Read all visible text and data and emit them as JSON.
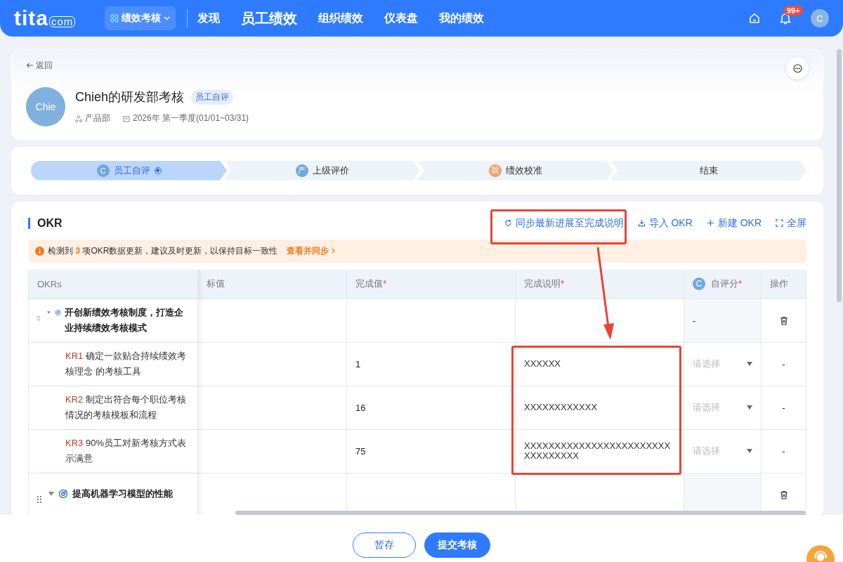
{
  "nav": {
    "logo": "tita",
    "logo_suffix": "com",
    "module": "绩效考核",
    "items": [
      {
        "label": "发现",
        "selected": false
      },
      {
        "label": "员工绩效",
        "selected": true
      },
      {
        "label": "组织绩效",
        "selected": false
      },
      {
        "label": "仪表盘",
        "selected": false
      },
      {
        "label": "我的绩效",
        "selected": false
      }
    ],
    "notification_badge": "99+",
    "avatar": "C"
  },
  "header": {
    "back": "返回",
    "avatar": "Chie",
    "title": "Chieh的研发部考核",
    "tag": "员工自评",
    "department": "产品部",
    "period": "2026年 第一季度(01/01~03/31)"
  },
  "steps": [
    {
      "badge": "C",
      "label": "员工自评",
      "color": "#6fa8dc",
      "selected": true
    },
    {
      "badge": "产",
      "label": "上级评价",
      "color": "#6fa8dc",
      "selected": false
    },
    {
      "badge": "我",
      "label": "绩效校准",
      "color": "#f0a070",
      "selected": false
    },
    {
      "label": "结束",
      "selected": false
    }
  ],
  "okr": {
    "title": "OKR",
    "actions": [
      {
        "kind": "sync",
        "label": "同步最新进展至完成说明"
      },
      {
        "kind": "import",
        "label": "导入 OKR"
      },
      {
        "kind": "new",
        "label": "新建 OKR"
      },
      {
        "kind": "fullscreen",
        "label": "全屏"
      }
    ],
    "notice": {
      "prefix": "检测到",
      "count": "3",
      "suffix": "项OKR数据更新，建议及时更新，以保持目标一致性",
      "link": "查看并同步"
    },
    "table": {
      "columns": [
        {
          "label": "OKRs"
        },
        {
          "label": "标值"
        },
        {
          "label": "完成值",
          "mark": "*"
        },
        {
          "label": "完成说明",
          "mark": "*"
        },
        {
          "label": "自评分",
          "mark": "*",
          "badge": "C"
        },
        {
          "label": "操作"
        }
      ],
      "rows": [
        {
          "kind": "objective",
          "title": "开创新绩效考核制度，打造企业持续绩效考核模式",
          "score": "-"
        },
        {
          "kind": "kr",
          "code": "KR1",
          "title": "确定一款贴合持续绩效考核理念 的考核工具",
          "done": "1",
          "note": "XXXXXX",
          "score_placeholder": "请选择",
          "op": "-"
        },
        {
          "kind": "kr",
          "code": "KR2",
          "title": "制定出符合每个职位考核情况的考核模板和流程",
          "done": "16",
          "note": "XXXXXXXXXXXX",
          "score_placeholder": "请选择",
          "op": "-"
        },
        {
          "kind": "kr",
          "code": "KR3",
          "title": "90%员工对新考核方式表示满意",
          "done": "75",
          "note": "XXXXXXXXXXXXXXXXXXXXXXXXXXXXXXXXX",
          "score_placeholder": "请选择",
          "op": "-"
        },
        {
          "kind": "objective",
          "title": "提高机器学习模型的性能"
        }
      ]
    }
  },
  "footer": {
    "buttons": [
      {
        "kind": "secondary",
        "label": "暂存"
      },
      {
        "kind": "primary",
        "label": "提交考核"
      }
    ]
  }
}
